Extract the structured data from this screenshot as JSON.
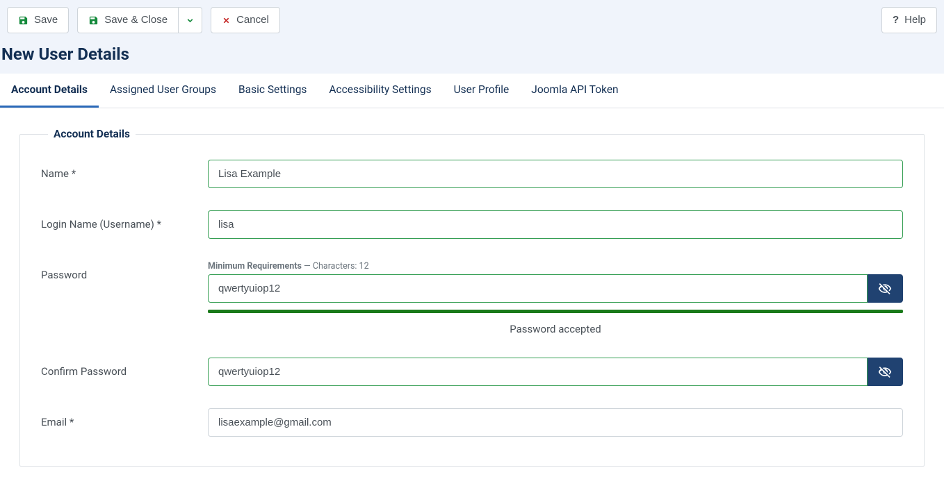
{
  "toolbar": {
    "save": "Save",
    "save_close": "Save & Close",
    "cancel": "Cancel",
    "help": "Help"
  },
  "page_title": "New User Details",
  "tabs": [
    "Account Details",
    "Assigned User Groups",
    "Basic Settings",
    "Accessibility Settings",
    "User Profile",
    "Joomla API Token"
  ],
  "active_tab": 0,
  "fieldset_legend": "Account Details",
  "labels": {
    "name": "Name *",
    "login": "Login Name (Username) *",
    "password": "Password",
    "confirm": "Confirm Password",
    "email": "Email *"
  },
  "password_hint": {
    "label": "Minimum Requirements",
    "sep": " — ",
    "detail": "Characters: 12"
  },
  "password_status": "Password accepted",
  "values": {
    "name": "Lisa Example",
    "login": "lisa",
    "password": "qwertyuiop12",
    "confirm": "qwertyuiop12",
    "email": "lisaexample@gmail.com"
  }
}
